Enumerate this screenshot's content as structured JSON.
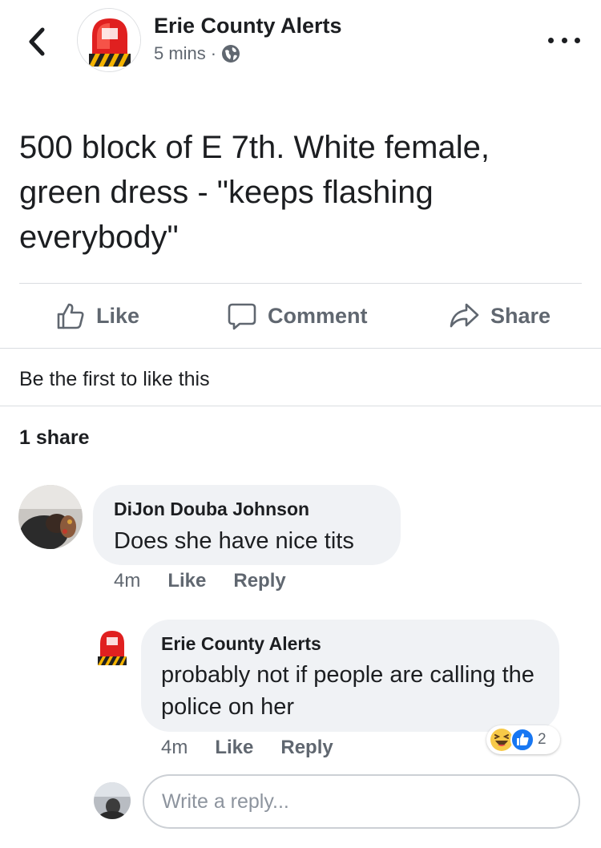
{
  "header": {
    "back_icon": "chevron-left-icon",
    "page_name": "Erie County Alerts",
    "time": "5 mins",
    "separator": "·",
    "privacy_icon": "globe-icon",
    "more_icon": "ellipsis-icon"
  },
  "post": {
    "text": "500 block of E 7th. White female, green dress - \"keeps flashing everybody\""
  },
  "actions": {
    "like_label": "Like",
    "comment_label": "Comment",
    "share_label": "Share"
  },
  "summary": {
    "likes_text": "Be the first to like this",
    "shares_text": "1 share"
  },
  "comments": [
    {
      "author": "DiJon Douba Johnson",
      "text": "Does she have nice tits",
      "time": "4m",
      "like_label": "Like",
      "reply_label": "Reply"
    },
    {
      "author": "Erie County Alerts",
      "text": "probably not if people are calling the police on her",
      "time": "4m",
      "like_label": "Like",
      "reply_label": "Reply",
      "reaction_icons": [
        "laughing-emoji-icon",
        "like-reaction-icon"
      ],
      "reaction_count": "2"
    }
  ],
  "reply_box": {
    "placeholder": "Write a reply..."
  },
  "colors": {
    "text": "#1c1e21",
    "secondary": "#606770",
    "bubble": "#f0f2f5",
    "fb_blue": "#1877f2",
    "siren_red": "#e02020",
    "hazard_yellow": "#f5b400"
  }
}
